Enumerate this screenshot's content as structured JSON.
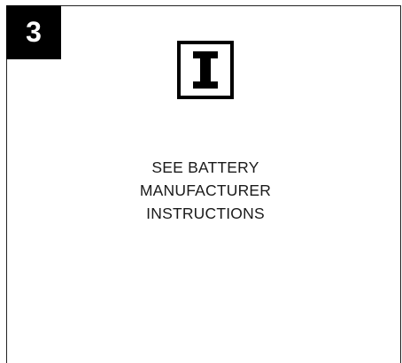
{
  "step": {
    "number": "3"
  },
  "icon": {
    "name": "info-i-icon",
    "label": "I"
  },
  "instructions": {
    "lines": [
      "SEE BATTERY",
      "MANUFACTURER",
      "INSTRUCTIONS"
    ]
  },
  "colors": {
    "badge_background": "#000000",
    "badge_text": "#ffffff",
    "text": "#1a1a1a",
    "border": "#222222"
  }
}
